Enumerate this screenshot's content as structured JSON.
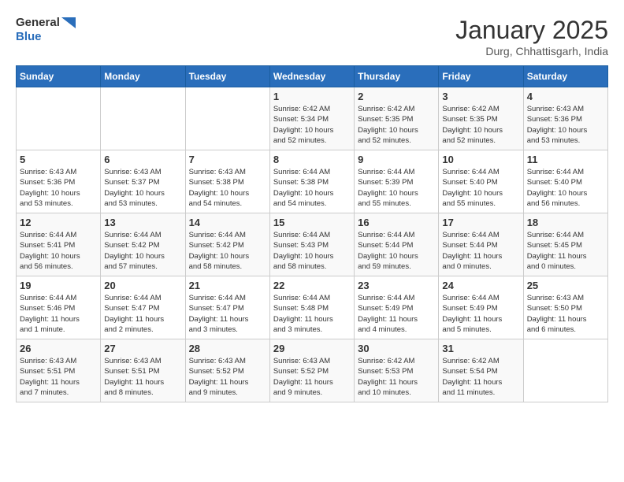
{
  "logo": {
    "line1": "General",
    "line2": "Blue"
  },
  "title": "January 2025",
  "subtitle": "Durg, Chhattisgarh, India",
  "days_of_week": [
    "Sunday",
    "Monday",
    "Tuesday",
    "Wednesday",
    "Thursday",
    "Friday",
    "Saturday"
  ],
  "weeks": [
    [
      {
        "day": "",
        "info": ""
      },
      {
        "day": "",
        "info": ""
      },
      {
        "day": "",
        "info": ""
      },
      {
        "day": "1",
        "info": "Sunrise: 6:42 AM\nSunset: 5:34 PM\nDaylight: 10 hours\nand 52 minutes."
      },
      {
        "day": "2",
        "info": "Sunrise: 6:42 AM\nSunset: 5:35 PM\nDaylight: 10 hours\nand 52 minutes."
      },
      {
        "day": "3",
        "info": "Sunrise: 6:42 AM\nSunset: 5:35 PM\nDaylight: 10 hours\nand 52 minutes."
      },
      {
        "day": "4",
        "info": "Sunrise: 6:43 AM\nSunset: 5:36 PM\nDaylight: 10 hours\nand 53 minutes."
      }
    ],
    [
      {
        "day": "5",
        "info": "Sunrise: 6:43 AM\nSunset: 5:36 PM\nDaylight: 10 hours\nand 53 minutes."
      },
      {
        "day": "6",
        "info": "Sunrise: 6:43 AM\nSunset: 5:37 PM\nDaylight: 10 hours\nand 53 minutes."
      },
      {
        "day": "7",
        "info": "Sunrise: 6:43 AM\nSunset: 5:38 PM\nDaylight: 10 hours\nand 54 minutes."
      },
      {
        "day": "8",
        "info": "Sunrise: 6:44 AM\nSunset: 5:38 PM\nDaylight: 10 hours\nand 54 minutes."
      },
      {
        "day": "9",
        "info": "Sunrise: 6:44 AM\nSunset: 5:39 PM\nDaylight: 10 hours\nand 55 minutes."
      },
      {
        "day": "10",
        "info": "Sunrise: 6:44 AM\nSunset: 5:40 PM\nDaylight: 10 hours\nand 55 minutes."
      },
      {
        "day": "11",
        "info": "Sunrise: 6:44 AM\nSunset: 5:40 PM\nDaylight: 10 hours\nand 56 minutes."
      }
    ],
    [
      {
        "day": "12",
        "info": "Sunrise: 6:44 AM\nSunset: 5:41 PM\nDaylight: 10 hours\nand 56 minutes."
      },
      {
        "day": "13",
        "info": "Sunrise: 6:44 AM\nSunset: 5:42 PM\nDaylight: 10 hours\nand 57 minutes."
      },
      {
        "day": "14",
        "info": "Sunrise: 6:44 AM\nSunset: 5:42 PM\nDaylight: 10 hours\nand 58 minutes."
      },
      {
        "day": "15",
        "info": "Sunrise: 6:44 AM\nSunset: 5:43 PM\nDaylight: 10 hours\nand 58 minutes."
      },
      {
        "day": "16",
        "info": "Sunrise: 6:44 AM\nSunset: 5:44 PM\nDaylight: 10 hours\nand 59 minutes."
      },
      {
        "day": "17",
        "info": "Sunrise: 6:44 AM\nSunset: 5:44 PM\nDaylight: 11 hours\nand 0 minutes."
      },
      {
        "day": "18",
        "info": "Sunrise: 6:44 AM\nSunset: 5:45 PM\nDaylight: 11 hours\nand 0 minutes."
      }
    ],
    [
      {
        "day": "19",
        "info": "Sunrise: 6:44 AM\nSunset: 5:46 PM\nDaylight: 11 hours\nand 1 minute."
      },
      {
        "day": "20",
        "info": "Sunrise: 6:44 AM\nSunset: 5:47 PM\nDaylight: 11 hours\nand 2 minutes."
      },
      {
        "day": "21",
        "info": "Sunrise: 6:44 AM\nSunset: 5:47 PM\nDaylight: 11 hours\nand 3 minutes."
      },
      {
        "day": "22",
        "info": "Sunrise: 6:44 AM\nSunset: 5:48 PM\nDaylight: 11 hours\nand 3 minutes."
      },
      {
        "day": "23",
        "info": "Sunrise: 6:44 AM\nSunset: 5:49 PM\nDaylight: 11 hours\nand 4 minutes."
      },
      {
        "day": "24",
        "info": "Sunrise: 6:44 AM\nSunset: 5:49 PM\nDaylight: 11 hours\nand 5 minutes."
      },
      {
        "day": "25",
        "info": "Sunrise: 6:43 AM\nSunset: 5:50 PM\nDaylight: 11 hours\nand 6 minutes."
      }
    ],
    [
      {
        "day": "26",
        "info": "Sunrise: 6:43 AM\nSunset: 5:51 PM\nDaylight: 11 hours\nand 7 minutes."
      },
      {
        "day": "27",
        "info": "Sunrise: 6:43 AM\nSunset: 5:51 PM\nDaylight: 11 hours\nand 8 minutes."
      },
      {
        "day": "28",
        "info": "Sunrise: 6:43 AM\nSunset: 5:52 PM\nDaylight: 11 hours\nand 9 minutes."
      },
      {
        "day": "29",
        "info": "Sunrise: 6:43 AM\nSunset: 5:52 PM\nDaylight: 11 hours\nand 9 minutes."
      },
      {
        "day": "30",
        "info": "Sunrise: 6:42 AM\nSunset: 5:53 PM\nDaylight: 11 hours\nand 10 minutes."
      },
      {
        "day": "31",
        "info": "Sunrise: 6:42 AM\nSunset: 5:54 PM\nDaylight: 11 hours\nand 11 minutes."
      },
      {
        "day": "",
        "info": ""
      }
    ]
  ]
}
